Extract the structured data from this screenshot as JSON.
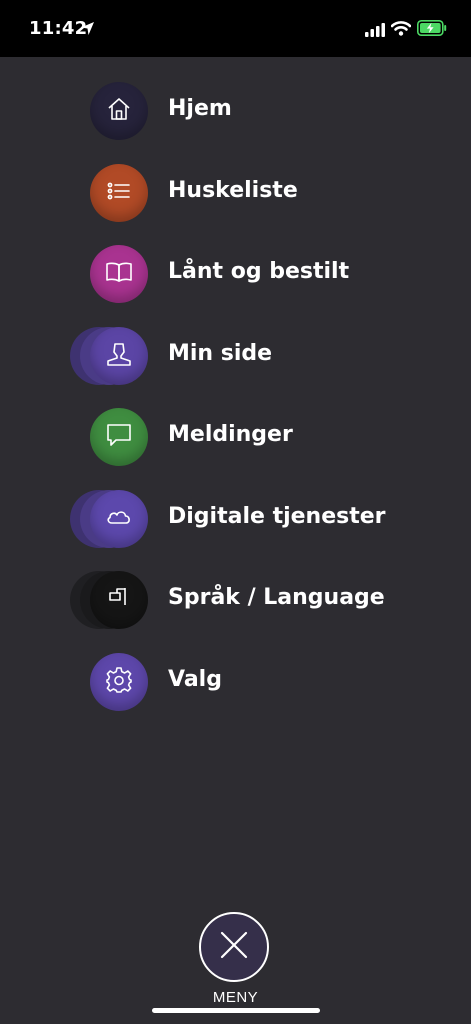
{
  "status_bar": {
    "time": "11:42",
    "icons": [
      "location-arrow-icon",
      "cellular-signal-icon",
      "wifi-icon",
      "battery-charging-icon"
    ],
    "battery_color": "#4cd964"
  },
  "menu": {
    "items": [
      {
        "label": "Hjem",
        "icon": "home-icon",
        "color": "#26233b"
      },
      {
        "label": "Huskeliste",
        "icon": "list-icon",
        "color": "#b14a26"
      },
      {
        "label": "Lånt og bestilt",
        "icon": "book-icon",
        "color": "#a93390"
      },
      {
        "label": "Min side",
        "icon": "person-icon",
        "color": "#5b45a5"
      },
      {
        "label": "Meldinger",
        "icon": "message-icon",
        "color": "#3f8d40"
      },
      {
        "label": "Digitale tjenester",
        "icon": "cloud-icon",
        "color": "#5c48ac"
      },
      {
        "label": "Språk / Language",
        "icon": "flag-icon",
        "color": "#151515"
      },
      {
        "label": "Valg",
        "icon": "gear-icon",
        "color": "#5d47aa"
      }
    ]
  },
  "close": {
    "label": "MENY",
    "icon": "close-icon"
  }
}
